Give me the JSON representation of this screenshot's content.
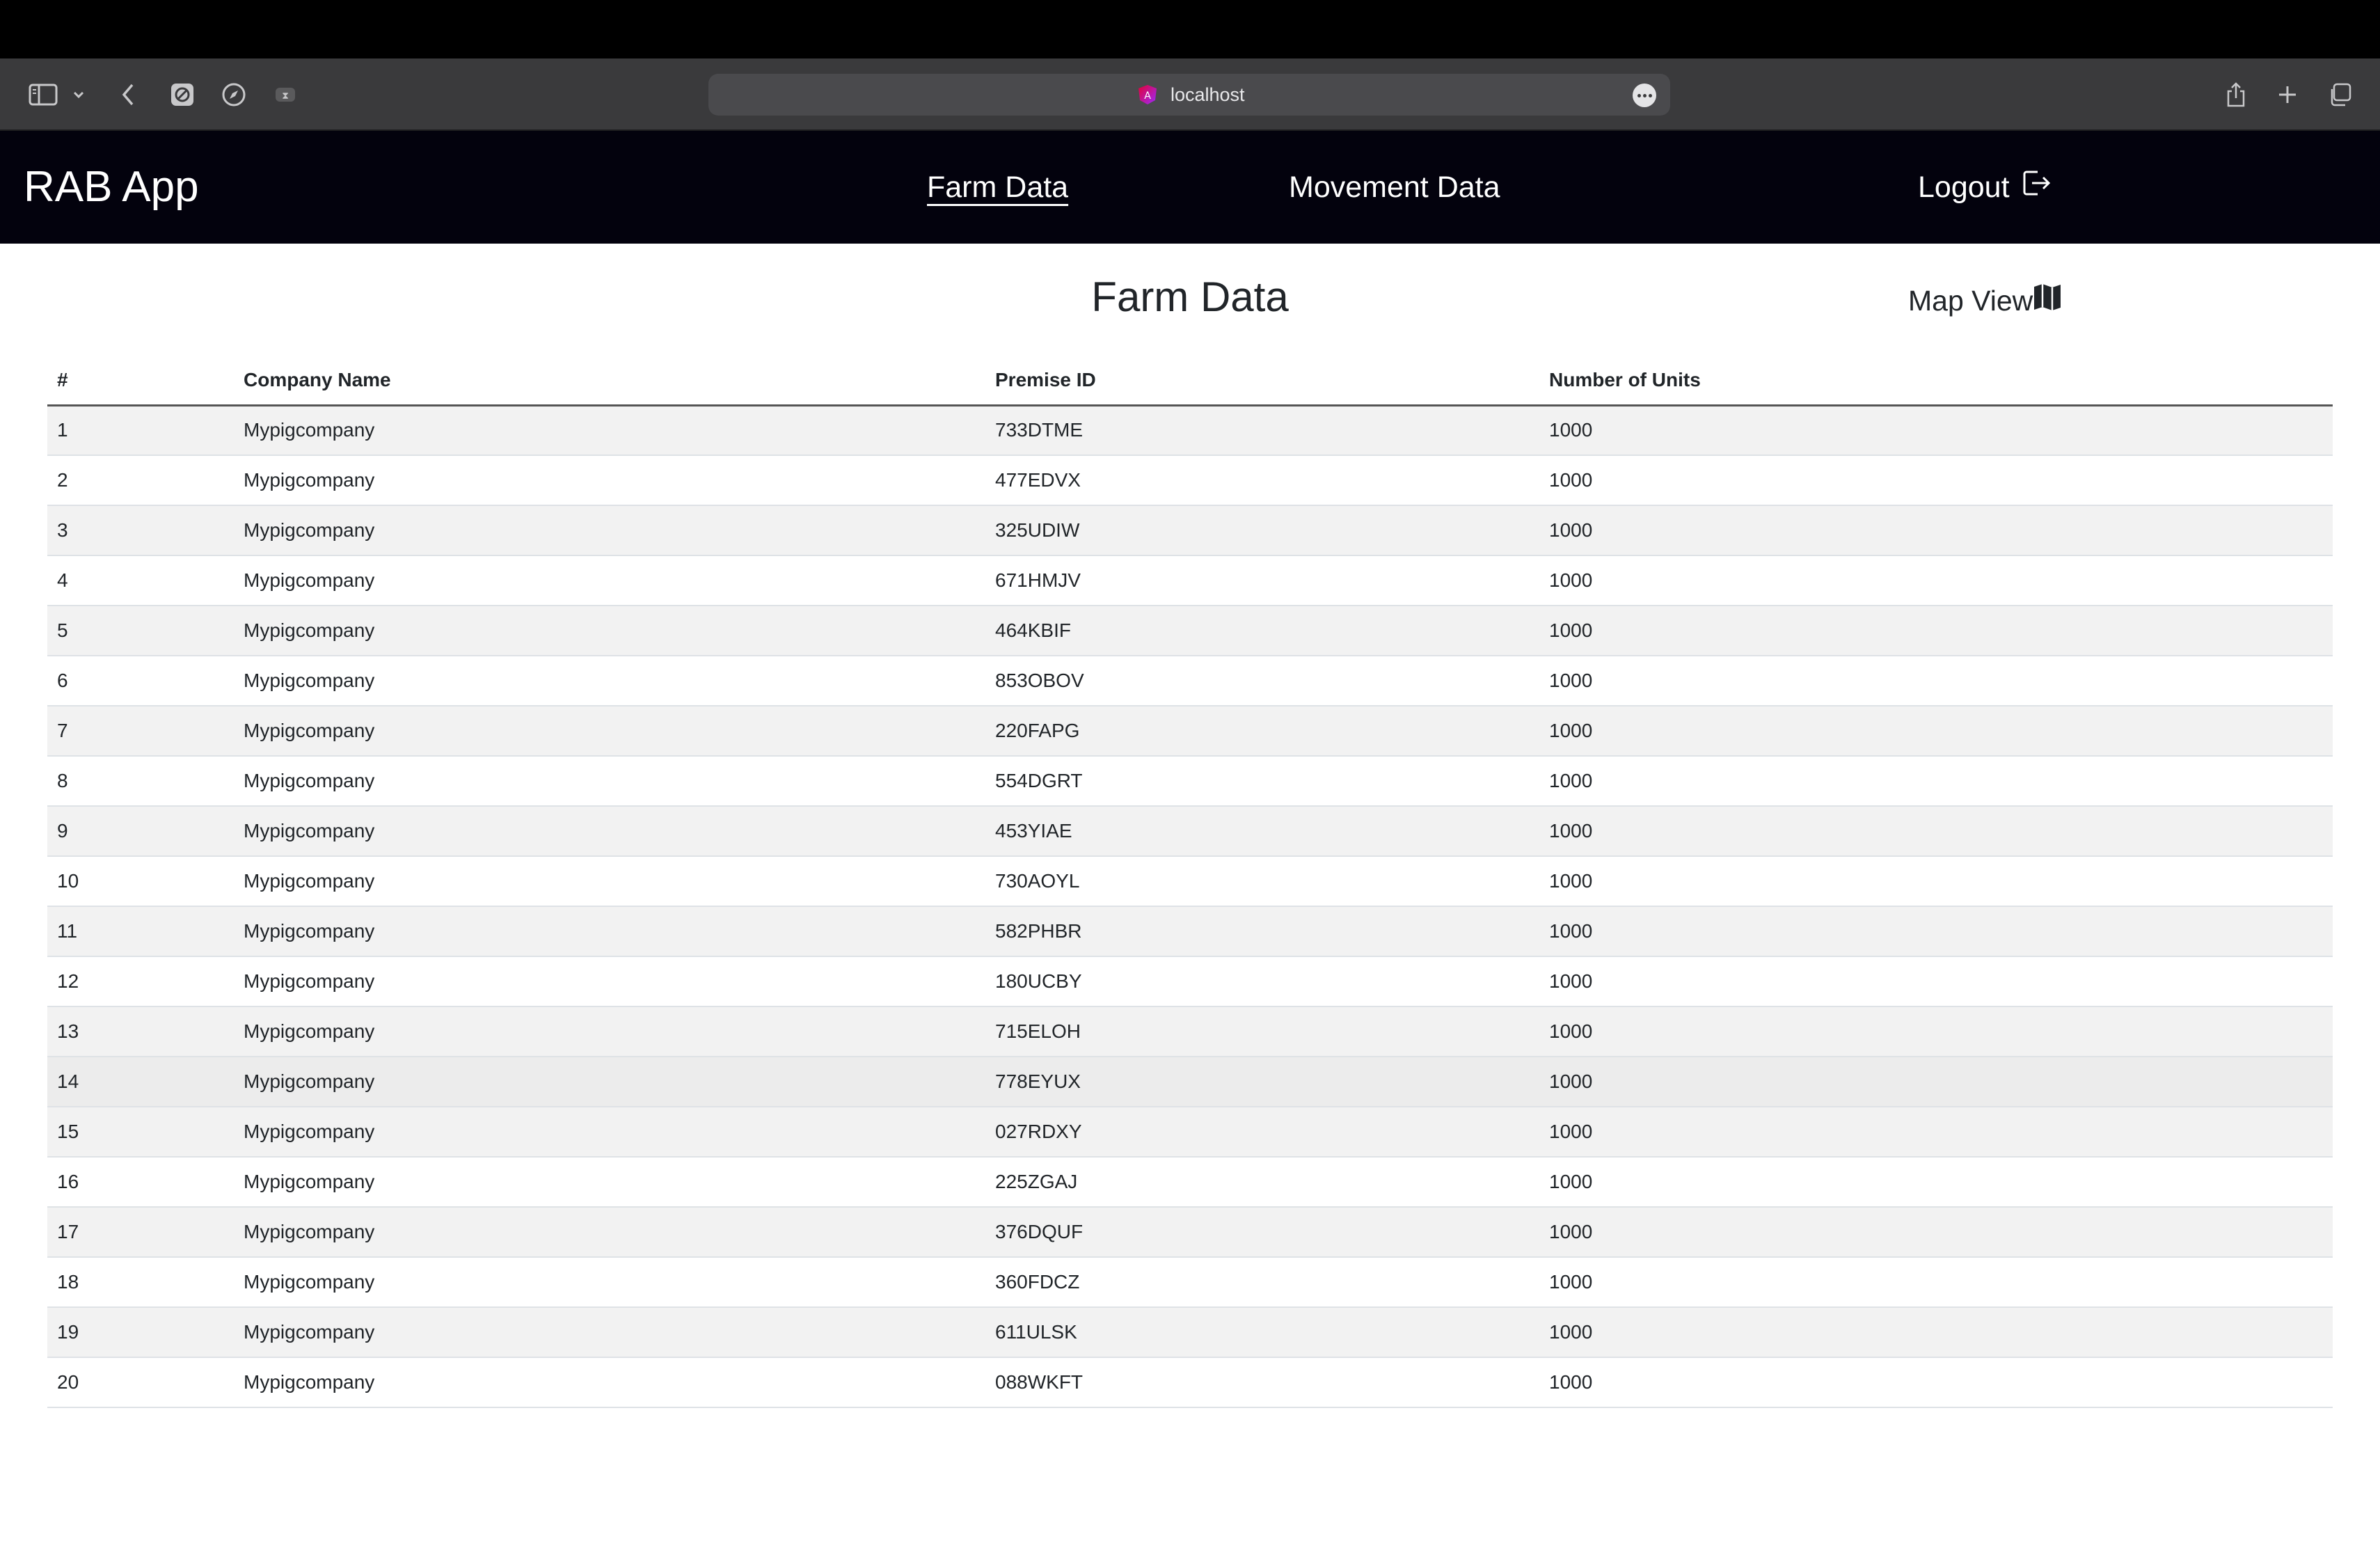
{
  "browser": {
    "url": "localhost",
    "icons": {
      "sidebar": "sidebar-icon",
      "sidebar_menu": "chevron-down-icon",
      "back": "chevron-left-icon",
      "ext1": "blocked-icon",
      "ext2": "compass-icon",
      "ext3": "privacy-icon",
      "site": "angular-icon",
      "more": "ellipsis-icon",
      "share": "share-icon",
      "new_tab": "plus-icon",
      "tabs": "tabs-overview-icon"
    }
  },
  "navbar": {
    "brand": "RAB App",
    "links": [
      {
        "label": "Farm Data",
        "active": true
      },
      {
        "label": "Movement Data",
        "active": false
      }
    ],
    "logout": {
      "label": "Logout",
      "icon": "logout-icon"
    }
  },
  "page": {
    "title": "Farm Data",
    "map_view": {
      "label": "Map View",
      "icon": "map-icon"
    }
  },
  "table": {
    "headers": [
      "#",
      "Company Name",
      "Premise ID",
      "Number of Units"
    ],
    "rows": [
      [
        "1",
        "Mypigcompany",
        "733DTME",
        "1000"
      ],
      [
        "2",
        "Mypigcompany",
        "477EDVX",
        "1000"
      ],
      [
        "3",
        "Mypigcompany",
        "325UDIW",
        "1000"
      ],
      [
        "4",
        "Mypigcompany",
        "671HMJV",
        "1000"
      ],
      [
        "5",
        "Mypigcompany",
        "464KBIF",
        "1000"
      ],
      [
        "6",
        "Mypigcompany",
        "853OBOV",
        "1000"
      ],
      [
        "7",
        "Mypigcompany",
        "220FAPG",
        "1000"
      ],
      [
        "8",
        "Mypigcompany",
        "554DGRT",
        "1000"
      ],
      [
        "9",
        "Mypigcompany",
        "453YIAE",
        "1000"
      ],
      [
        "10",
        "Mypigcompany",
        "730AOYL",
        "1000"
      ],
      [
        "11",
        "Mypigcompany",
        "582PHBR",
        "1000"
      ],
      [
        "12",
        "Mypigcompany",
        "180UCBY",
        "1000"
      ],
      [
        "13",
        "Mypigcompany",
        "715ELOH",
        "1000"
      ],
      [
        "14",
        "Mypigcompany",
        "778EYUX",
        "1000"
      ],
      [
        "15",
        "Mypigcompany",
        "027RDXY",
        "1000"
      ],
      [
        "16",
        "Mypigcompany",
        "225ZGAJ",
        "1000"
      ],
      [
        "17",
        "Mypigcompany",
        "376DQUF",
        "1000"
      ],
      [
        "18",
        "Mypigcompany",
        "360FDCZ",
        "1000"
      ],
      [
        "19",
        "Mypigcompany",
        "611ULSK",
        "1000"
      ],
      [
        "20",
        "Mypigcompany",
        "088WKFT",
        "1000"
      ]
    ]
  },
  "colors": {
    "navbar_bg": "#03020d",
    "browser_chrome": "#3a3a3c",
    "row_stripe": "#f2f2f2",
    "text": "#212529"
  }
}
